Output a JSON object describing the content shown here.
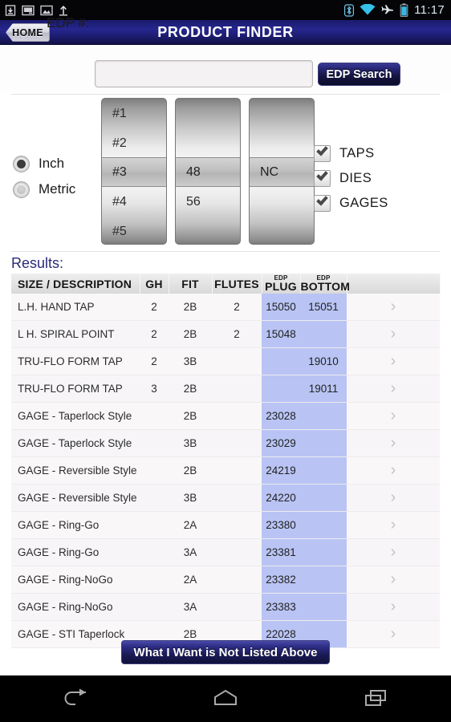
{
  "statusbar": {
    "clock": "11:17",
    "left_icons": [
      "download-icon",
      "screenshot-icon",
      "image-icon",
      "upload-icon"
    ],
    "right_icons": [
      "bluetooth-icon",
      "wifi-icon",
      "airplane-mode-icon",
      "battery-icon"
    ]
  },
  "titlebar": {
    "home_label": "HOME",
    "title": "PRODUCT FINDER"
  },
  "search": {
    "label": "EDP #:",
    "value": "",
    "placeholder": "",
    "button_label": "EDP Search"
  },
  "units": {
    "options": [
      {
        "label": "Inch",
        "selected": true
      },
      {
        "label": "Metric",
        "selected": false
      }
    ]
  },
  "wheels": [
    {
      "name": "size-wheel",
      "items": [
        "#1",
        "#2",
        "#4",
        "#5"
      ],
      "selected": "#3"
    },
    {
      "name": "threads-wheel",
      "items": [
        "",
        "",
        "56",
        ""
      ],
      "selected": "48"
    },
    {
      "name": "series-wheel",
      "items": [
        "",
        "",
        "",
        ""
      ],
      "selected": "NC"
    }
  ],
  "filters": [
    {
      "label": "TAPS",
      "checked": true
    },
    {
      "label": "DIES",
      "checked": true
    },
    {
      "label": "GAGES",
      "checked": true
    }
  ],
  "results": {
    "title": "Results:",
    "columns": [
      {
        "key": "desc",
        "label": "SIZE / DESCRIPTION",
        "sup": ""
      },
      {
        "key": "gh",
        "label": "GH",
        "sup": ""
      },
      {
        "key": "fit",
        "label": "FIT",
        "sup": ""
      },
      {
        "key": "flutes",
        "label": "FLUTES",
        "sup": ""
      },
      {
        "key": "plug",
        "label": "PLUG",
        "sup": "EDP"
      },
      {
        "key": "bottom",
        "label": "BOTTOM",
        "sup": "EDP"
      },
      {
        "key": "chev",
        "label": "",
        "sup": ""
      }
    ],
    "rows": [
      {
        "desc": "L.H. HAND TAP",
        "style": "red",
        "gh": "2",
        "fit": "2B",
        "flutes": "2",
        "plug": "15050",
        "bottom": "15051"
      },
      {
        "desc": "L H. SPIRAL POINT",
        "style": "red",
        "gh": "2",
        "fit": "2B",
        "flutes": "2",
        "plug": "15048",
        "bottom": ""
      },
      {
        "desc": "TRU-FLO FORM TAP",
        "style": "red",
        "gh": "2",
        "fit": "3B",
        "flutes": "",
        "plug": "",
        "bottom": "19010"
      },
      {
        "desc": "TRU-FLO FORM TAP",
        "style": "red",
        "gh": "3",
        "fit": "2B",
        "flutes": "",
        "plug": "",
        "bottom": "19011"
      },
      {
        "desc": "GAGE - Taperlock Style",
        "style": "dark",
        "gh": "",
        "fit": "2B",
        "flutes": "",
        "plug": "23028",
        "bottom": ""
      },
      {
        "desc": "GAGE - Taperlock Style",
        "style": "dark",
        "gh": "",
        "fit": "3B",
        "flutes": "",
        "plug": "23029",
        "bottom": ""
      },
      {
        "desc": "GAGE - Reversible Style",
        "style": "dark",
        "gh": "",
        "fit": "2B",
        "flutes": "",
        "plug": "24219",
        "bottom": ""
      },
      {
        "desc": "GAGE - Reversible Style",
        "style": "dark",
        "gh": "",
        "fit": "3B",
        "flutes": "",
        "plug": "24220",
        "bottom": ""
      },
      {
        "desc": "GAGE - Ring-Go",
        "style": "dark",
        "gh": "",
        "fit": "2A",
        "flutes": "",
        "plug": "23380",
        "bottom": ""
      },
      {
        "desc": "GAGE - Ring-Go",
        "style": "dark",
        "gh": "",
        "fit": "3A",
        "flutes": "",
        "plug": "23381",
        "bottom": ""
      },
      {
        "desc": "GAGE - Ring-NoGo",
        "style": "dark",
        "gh": "",
        "fit": "2A",
        "flutes": "",
        "plug": "23382",
        "bottom": ""
      },
      {
        "desc": "GAGE - Ring-NoGo",
        "style": "dark",
        "gh": "",
        "fit": "3A",
        "flutes": "",
        "plug": "23383",
        "bottom": ""
      },
      {
        "desc": "GAGE - STI Taperlock",
        "style": "dark",
        "gh": "",
        "fit": "2B",
        "flutes": "",
        "plug": "22028",
        "bottom": ""
      }
    ]
  },
  "footer": {
    "not_listed_label": "What I Want is Not Listed Above"
  },
  "navbar": {
    "items": [
      "back-icon",
      "home-icon",
      "recents-icon"
    ]
  },
  "colors": {
    "title_bar": "#1b1b6e",
    "accent_button": "#25256f",
    "desc_red": "#cf4444",
    "edp_chip": "#b9c4f4",
    "results_title": "#2a2a7a"
  }
}
